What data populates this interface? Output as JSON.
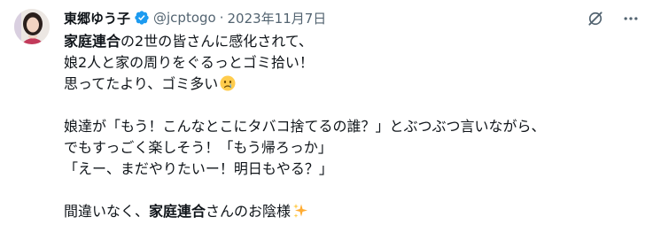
{
  "author": {
    "name": "東郷ゆう子",
    "handle": "@jcptogo",
    "separator": "·",
    "date": "2023年11月7日",
    "verified_color": "#1d9bf0"
  },
  "icons": {
    "grok": "grok-icon",
    "more": "more-icon",
    "verified": "verified-badge-icon",
    "crying_face": "crying-face-emoji",
    "sparkles": "sparkles-emoji"
  },
  "tweet": {
    "line1_bold": "家庭連合",
    "line1_rest": "の2世の皆さんに感化されて、",
    "line2": "娘2人と家の周りをぐるっとゴミ拾い！",
    "line3": "思ってたより、ゴミ多い",
    "line4": "娘達が「もう！こんなとこにタバコ捨てるの誰？」とぶつぶつ言いながら、",
    "line5": "でもすっごく楽しそう！「もう帰ろっか」",
    "line6": "「えー、まだやりたいー！明日もやる？」",
    "line7_pre": "間違いなく、",
    "line7_bold": "家庭連合",
    "line7_post": "さんのお陰様"
  }
}
